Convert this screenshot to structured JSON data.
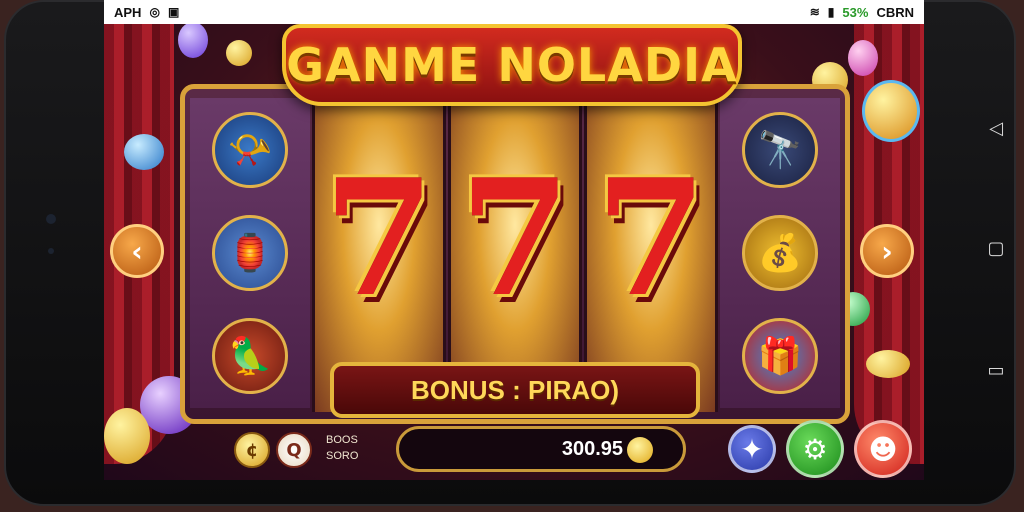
{
  "status_bar": {
    "left_text": "APH",
    "right_text": "53%",
    "right_text2": "CBRN"
  },
  "game": {
    "title": "GANME NOLADIA",
    "reels": [
      "7",
      "7",
      "7"
    ],
    "bonus_label": "BONUS : PIRAO)",
    "balance": "300.95",
    "small_label_line1": "BOOS",
    "small_label_line2": "SORO"
  },
  "icons": {
    "left_symbols": [
      "horn-icon",
      "lantern-icon",
      "parrot-icon"
    ],
    "right_symbols": [
      "cannon-icon",
      "bag-icon",
      "treasure-icon"
    ],
    "buttons": [
      "star-icon",
      "settings-icon",
      "profile-icon"
    ]
  },
  "colors": {
    "accent_gold": "#f4c431",
    "seven_red": "#e32020",
    "settings_green": "#2aa02a",
    "profile_red": "#e03a2a",
    "star_blue": "#2a3aa8"
  }
}
